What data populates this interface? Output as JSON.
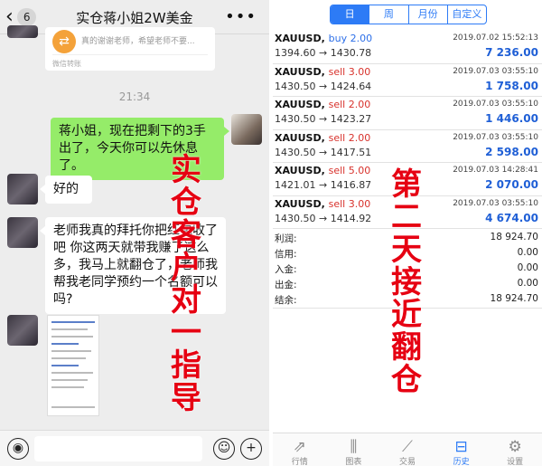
{
  "chat": {
    "back_count": "6",
    "title": "实仓蒋小姐2W美金",
    "share_card": {
      "desc": "真的谢谢老师，希望老师不要...",
      "source": "微信转账"
    },
    "time": "21:34",
    "messages": [
      {
        "from": "me",
        "text": "蒋小姐，现在把剩下的3手出了，今天你可以先休息了。"
      },
      {
        "from": "other",
        "text": "好的"
      },
      {
        "from": "other",
        "text": "老师我真的拜托你把红包收了吧 你这两天就带我赚了这么多，我马上就翻仓了，老师我帮我老同学预约一个名额可以吗?"
      }
    ],
    "overlay_text": [
      "实",
      "仓",
      "客",
      "户",
      "对",
      "一",
      "指",
      "导"
    ]
  },
  "trade": {
    "segments": [
      {
        "label": "日",
        "active": true
      },
      {
        "label": "周",
        "active": false
      },
      {
        "label": "月份",
        "active": false
      },
      {
        "label": "自定义",
        "active": false
      }
    ],
    "deals": [
      {
        "symbol": "XAUUSD,",
        "side": "buy 2.00",
        "dir": "buy",
        "date": "2019.07.02 15:52:13",
        "prices": "1394.60 → 1430.78",
        "profit": "7 236.00"
      },
      {
        "symbol": "XAUUSD,",
        "side": "sell 3.00",
        "dir": "sell",
        "date": "2019.07.03 03:55:10",
        "prices": "1430.50 → 1424.64",
        "profit": "1 758.00"
      },
      {
        "symbol": "XAUUSD,",
        "side": "sell 2.00",
        "dir": "sell",
        "date": "2019.07.03 03:55:10",
        "prices": "1430.50 → 1423.27",
        "profit": "1 446.00"
      },
      {
        "symbol": "XAUUSD,",
        "side": "sell 2.00",
        "dir": "sell",
        "date": "2019.07.03 03:55:10",
        "prices": "1430.50 → 1417.51",
        "profit": "2 598.00"
      },
      {
        "symbol": "XAUUSD,",
        "side": "sell 5.00",
        "dir": "sell",
        "date": "2019.07.03 14:28:41",
        "prices": "1421.01 → 1416.87",
        "profit": "2 070.00"
      },
      {
        "symbol": "XAUUSD,",
        "side": "sell 3.00",
        "dir": "sell",
        "date": "2019.07.03 03:55:10",
        "prices": "1430.50 → 1414.92",
        "profit": "4 674.00"
      }
    ],
    "summary": [
      {
        "label": "利润:",
        "value": "18 924.70"
      },
      {
        "label": "信用:",
        "value": "0.00"
      },
      {
        "label": "入金:",
        "value": "0.00"
      },
      {
        "label": "出金:",
        "value": "0.00"
      },
      {
        "label": "结余:",
        "value": "18 924.70"
      }
    ],
    "overlay_text": [
      "第",
      "二",
      "天",
      "接",
      "近",
      "翻",
      "仓"
    ],
    "tabs": [
      {
        "label": "行情",
        "icon": "quotes-icon",
        "active": false
      },
      {
        "label": "图表",
        "icon": "chart-icon",
        "active": false
      },
      {
        "label": "交易",
        "icon": "trade-icon",
        "active": false
      },
      {
        "label": "历史",
        "icon": "history-icon",
        "active": true
      },
      {
        "label": "设置",
        "icon": "settings-icon",
        "active": false
      }
    ]
  },
  "colors": {
    "accent": "#2d7bf6",
    "sell": "#d8322c",
    "overlay": "#e60012",
    "bubble_green": "#95ec69"
  }
}
